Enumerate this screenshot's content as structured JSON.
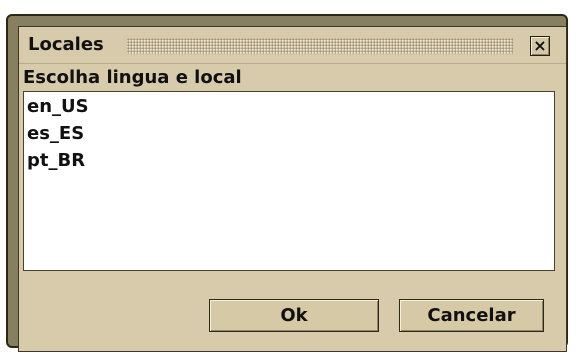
{
  "dialog": {
    "title": "Locales",
    "close_icon_glyph": "×",
    "prompt": "Escolha lingua e local",
    "items": [
      "en_US",
      "es_ES",
      "pt_BR"
    ],
    "buttons": {
      "ok": "Ok",
      "cancel": "Cancelar"
    }
  },
  "colors": {
    "frame": "#87805f",
    "panel": "#d8cbab",
    "list_background": "#ffffff",
    "border": "#2a2814"
  },
  "icons": [
    "close-icon",
    "title-grip-pattern"
  ]
}
